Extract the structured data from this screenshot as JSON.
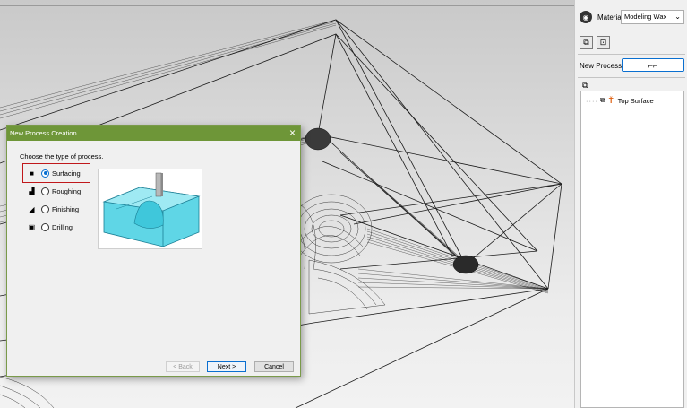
{
  "sidebar": {
    "material_label": "Material",
    "material_value": "Modeling Wax",
    "new_process_label": "New Process",
    "tree": {
      "node_label": "Top Surface"
    }
  },
  "dialog": {
    "title": "New Process Creation",
    "instruction": "Choose the type of process.",
    "options": [
      {
        "label": "Surfacing",
        "selected": true
      },
      {
        "label": "Roughing",
        "selected": false
      },
      {
        "label": "Finishing",
        "selected": false
      },
      {
        "label": "Drilling",
        "selected": false
      }
    ],
    "back_label": "< Back",
    "next_label": "Next >",
    "cancel_label": "Cancel"
  },
  "icons": {
    "material": "gauge-icon",
    "toolbar": [
      "stock-box-icon",
      "target-icon"
    ],
    "new_process": "toolpath-icon",
    "tree_tab": "process-list-icon",
    "options": [
      "surfacing-icon",
      "roughing-icon",
      "finishing-icon",
      "drilling-icon"
    ]
  },
  "colors": {
    "dialog_title_bar": "#6e9638",
    "selection_box": "#c0181b",
    "accent": "#0a6fd0",
    "preview_fill": "#5fd6e6"
  }
}
